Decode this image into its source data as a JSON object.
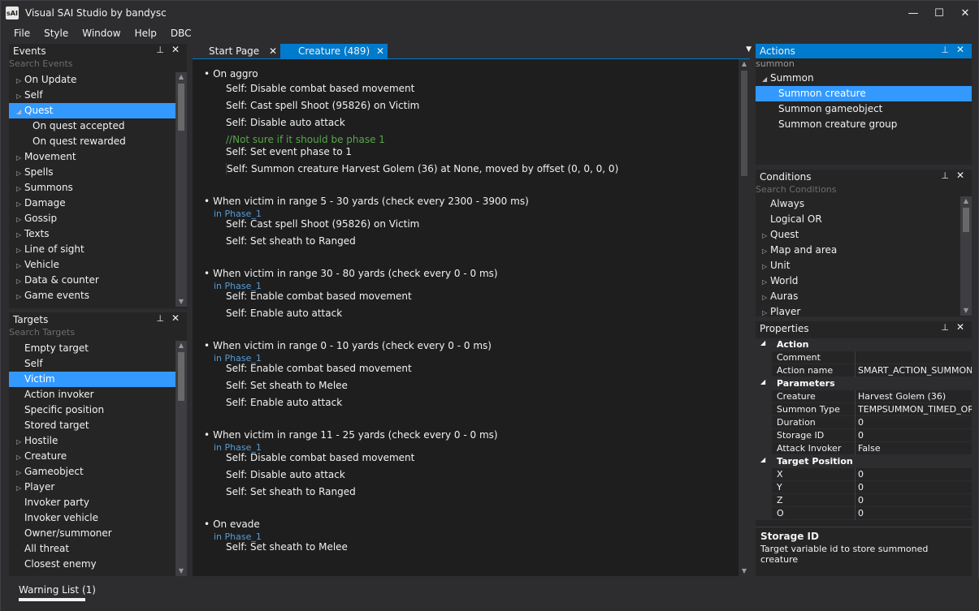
{
  "app": {
    "icon": "sAI",
    "title": "Visual SAI Studio by bandysc"
  },
  "window": {
    "minimize": "—",
    "maximize": "☐",
    "close": "✕"
  },
  "menu": [
    "File",
    "Style",
    "Window",
    "Help",
    "DBC"
  ],
  "events_panel": {
    "title": "Events",
    "search": "Search Events",
    "items": [
      {
        "label": "On Update",
        "arrow": "right",
        "indent": 0
      },
      {
        "label": "Self",
        "arrow": "right",
        "indent": 0
      },
      {
        "label": "Quest",
        "arrow": "down",
        "indent": 0,
        "selected": true
      },
      {
        "label": "On quest accepted",
        "arrow": "",
        "indent": 1
      },
      {
        "label": "On quest rewarded",
        "arrow": "",
        "indent": 1
      },
      {
        "label": "Movement",
        "arrow": "right",
        "indent": 0
      },
      {
        "label": "Spells",
        "arrow": "right",
        "indent": 0
      },
      {
        "label": "Summons",
        "arrow": "right",
        "indent": 0
      },
      {
        "label": "Damage",
        "arrow": "right",
        "indent": 0
      },
      {
        "label": "Gossip",
        "arrow": "right",
        "indent": 0
      },
      {
        "label": "Texts",
        "arrow": "right",
        "indent": 0
      },
      {
        "label": "Line of sight",
        "arrow": "right",
        "indent": 0
      },
      {
        "label": "Vehicle",
        "arrow": "right",
        "indent": 0
      },
      {
        "label": "Data & counter",
        "arrow": "right",
        "indent": 0
      },
      {
        "label": "Game events",
        "arrow": "right",
        "indent": 0
      }
    ]
  },
  "targets_panel": {
    "title": "Targets",
    "search": "Search Targets",
    "items": [
      {
        "label": "Empty target",
        "arrow": ""
      },
      {
        "label": "Self",
        "arrow": ""
      },
      {
        "label": "Victim",
        "arrow": "",
        "selected": true
      },
      {
        "label": "Action invoker",
        "arrow": ""
      },
      {
        "label": "Specific position",
        "arrow": ""
      },
      {
        "label": "Stored target",
        "arrow": ""
      },
      {
        "label": "Hostile",
        "arrow": "right"
      },
      {
        "label": "Creature",
        "arrow": "right"
      },
      {
        "label": "Gameobject",
        "arrow": "right"
      },
      {
        "label": "Player",
        "arrow": "right"
      },
      {
        "label": "Invoker party",
        "arrow": ""
      },
      {
        "label": "Invoker vehicle",
        "arrow": ""
      },
      {
        "label": "Owner/summoner",
        "arrow": ""
      },
      {
        "label": "All threat",
        "arrow": ""
      },
      {
        "label": "Closest enemy",
        "arrow": ""
      }
    ]
  },
  "tabs": [
    {
      "label": "Start Page",
      "active": false
    },
    {
      "label": "Creature (489)",
      "active": true
    }
  ],
  "script": [
    {
      "event": "On aggro",
      "phase": "",
      "actions": [
        {
          "text": "Self: Disable combat based movement"
        },
        {
          "text": "Self: Cast spell Shoot (95826) on Victim"
        },
        {
          "text": "Self: Disable auto attack"
        },
        {
          "comment": "//Not sure if it should be phase 1",
          "text": "Self: Set event phase to 1"
        },
        {
          "text": "Self: Summon creature Harvest Golem (36) at None, moved by offset (0, 0, 0, 0)",
          "boxed": true
        }
      ]
    },
    {
      "event": "When victim in range 5 - 30 yards (check every 2300 - 3900 ms)",
      "phase": "in Phase_1",
      "actions": [
        {
          "text": "Self: Cast spell Shoot (95826) on Victim"
        },
        {
          "text": "Self: Set sheath to Ranged"
        }
      ]
    },
    {
      "event": "When victim in range 30 - 80 yards (check every 0 - 0 ms)",
      "phase": "in Phase_1",
      "actions": [
        {
          "text": "Self: Enable combat based movement"
        },
        {
          "text": "Self: Enable auto attack"
        }
      ]
    },
    {
      "event": "When victim in range 0 - 10 yards (check every 0 - 0 ms)",
      "phase": "in Phase_1",
      "actions": [
        {
          "text": "Self: Enable combat based movement"
        },
        {
          "text": "Self: Set sheath to Melee"
        },
        {
          "text": "Self: Enable auto attack"
        }
      ]
    },
    {
      "event": "When victim in range 11 - 25 yards (check every 0 - 0 ms)",
      "phase": "in Phase_1",
      "actions": [
        {
          "text": "Self: Disable combat based movement"
        },
        {
          "text": "Self: Disable auto attack"
        },
        {
          "text": "Self: Set sheath to Ranged"
        }
      ]
    },
    {
      "event": "On evade",
      "phase": "in Phase_1",
      "actions": [
        {
          "text": "Self: Set sheath to Melee"
        }
      ]
    }
  ],
  "actions_panel": {
    "title": "Actions",
    "search": "summon",
    "items": [
      {
        "label": "Summon",
        "arrow": "down",
        "indent": 0
      },
      {
        "label": "Summon creature",
        "arrow": "",
        "indent": 1,
        "selected": true
      },
      {
        "label": "Summon gameobject",
        "arrow": "",
        "indent": 1
      },
      {
        "label": "Summon creature group",
        "arrow": "",
        "indent": 1
      }
    ]
  },
  "conditions_panel": {
    "title": "Conditions",
    "search": "Search Conditions",
    "items": [
      {
        "label": "Always",
        "arrow": ""
      },
      {
        "label": "Logical OR",
        "arrow": ""
      },
      {
        "label": "Quest",
        "arrow": "right"
      },
      {
        "label": "Map and area",
        "arrow": "right"
      },
      {
        "label": "Unit",
        "arrow": "right"
      },
      {
        "label": "World",
        "arrow": "right"
      },
      {
        "label": "Auras",
        "arrow": "right"
      },
      {
        "label": "Player",
        "arrow": "right"
      }
    ]
  },
  "properties_panel": {
    "title": "Properties",
    "rows": [
      {
        "group": "Action"
      },
      {
        "key": "Comment",
        "value": ""
      },
      {
        "key": "Action name",
        "value": "SMART_ACTION_SUMMON_CREATURE"
      },
      {
        "group": "Parameters"
      },
      {
        "key": "Creature",
        "value": "Harvest Golem (36)"
      },
      {
        "key": "Summon Type",
        "value": "TEMPSUMMON_TIMED_OR_DEAD_DESPAWN"
      },
      {
        "key": "Duration",
        "value": "0"
      },
      {
        "key": "Storage ID",
        "value": "0"
      },
      {
        "key": "Attack Invoker",
        "value": "False"
      },
      {
        "group": "Target Position"
      },
      {
        "key": "X",
        "value": "0"
      },
      {
        "key": "Y",
        "value": "0"
      },
      {
        "key": "Z",
        "value": "0"
      },
      {
        "key": "O",
        "value": "0"
      }
    ],
    "desc_title": "Storage ID",
    "desc_text": "Target variable id to store summoned creature"
  },
  "status": {
    "warning_list": "Warning List (1)"
  },
  "icons": {
    "pin": "pin-icon",
    "close": "close-icon",
    "expand": "triangle-right-icon",
    "collapse": "triangle-down-icon",
    "dropdown": "chevron-down-icon"
  },
  "colors": {
    "accent": "#007acc",
    "selection": "#3399ff",
    "editor_bg": "#1e1e1e",
    "panel_bg": "#252526",
    "phase": "#569cd6",
    "comment": "#57a64a"
  }
}
